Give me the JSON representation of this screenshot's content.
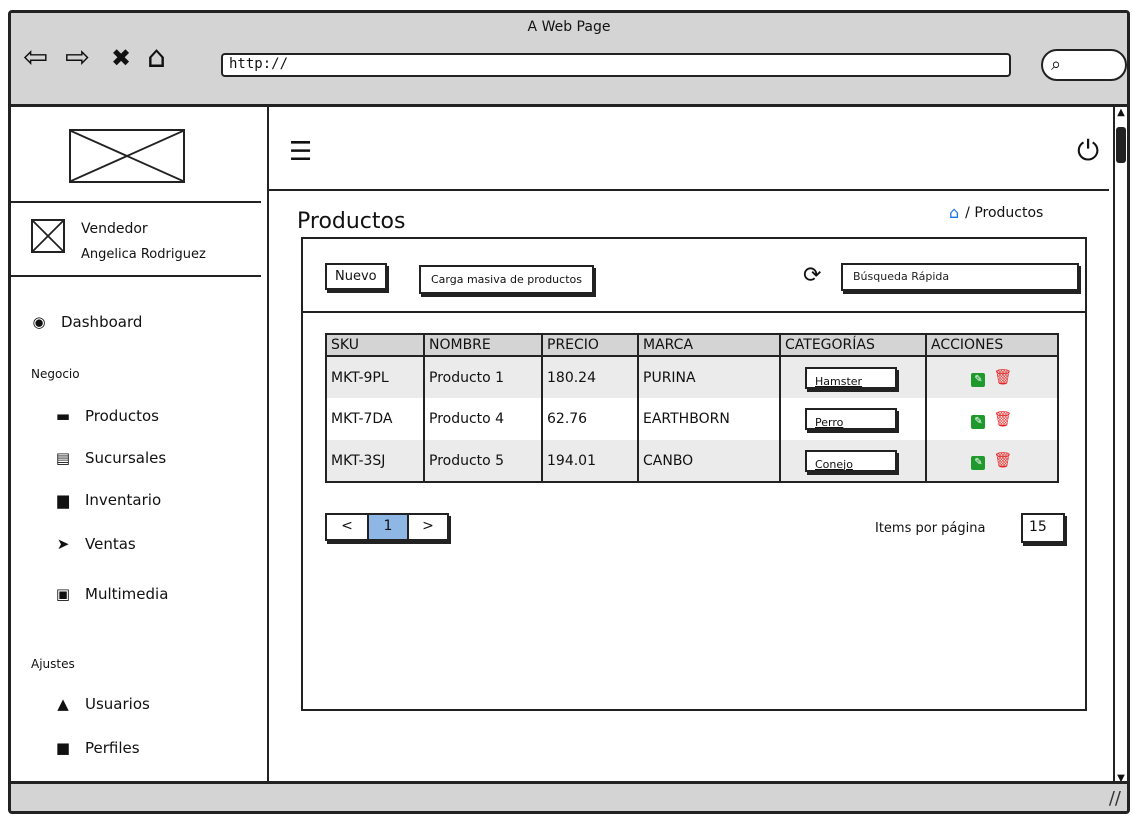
{
  "window": {
    "title": "A Web Page",
    "url": "http://"
  },
  "sidebar": {
    "role": "Vendedor",
    "user": "Angelica Rodriguez",
    "dashboard": "Dashboard",
    "section_negocio": "Negocio",
    "items": [
      {
        "label": "Productos",
        "icon": "briefcase-icon"
      },
      {
        "label": "Sucursales",
        "icon": "building-icon"
      },
      {
        "label": "Inventario",
        "icon": "archive-icon"
      },
      {
        "label": "Ventas",
        "icon": "paper-plane-icon"
      },
      {
        "label": "Multimedia",
        "icon": "image-icon"
      }
    ],
    "section_ajustes": "Ajustes",
    "settings": [
      {
        "label": "Usuarios",
        "icon": "user-lock-icon"
      },
      {
        "label": "Perfiles",
        "icon": "lock-icon"
      }
    ]
  },
  "page": {
    "title": "Productos",
    "breadcrumb": "/ Productos"
  },
  "toolbar": {
    "new_label": "Nuevo",
    "bulk_label": "Carga masiva de productos",
    "search_placeholder": "Búsqueda Rápida"
  },
  "table": {
    "headers": [
      "SKU",
      "NOMBRE",
      "PRECIO",
      "MARCA",
      "CATEGORÍAS",
      "ACCIONES"
    ],
    "rows": [
      {
        "sku": "MKT-9PL",
        "nombre": "Producto 1",
        "precio": "180.24",
        "marca": "PURINA",
        "categoria": "Hamster"
      },
      {
        "sku": "MKT-7DA",
        "nombre": "Producto 4",
        "precio": "62.76",
        "marca": "EARTHBORN",
        "categoria": "Perro"
      },
      {
        "sku": "MKT-3SJ",
        "nombre": "Producto 5",
        "precio": "194.01",
        "marca": "CANBO",
        "categoria": "Conejo"
      }
    ]
  },
  "pagination": {
    "prev": "<",
    "current": "1",
    "next": ">",
    "items_per_page_label": "Items por página",
    "items_per_page": "15"
  },
  "colors": {
    "edit": "#1e9a2c",
    "delete": "#e32525",
    "active_page": "#8fb7e6",
    "home_icon": "#1a73e8"
  }
}
